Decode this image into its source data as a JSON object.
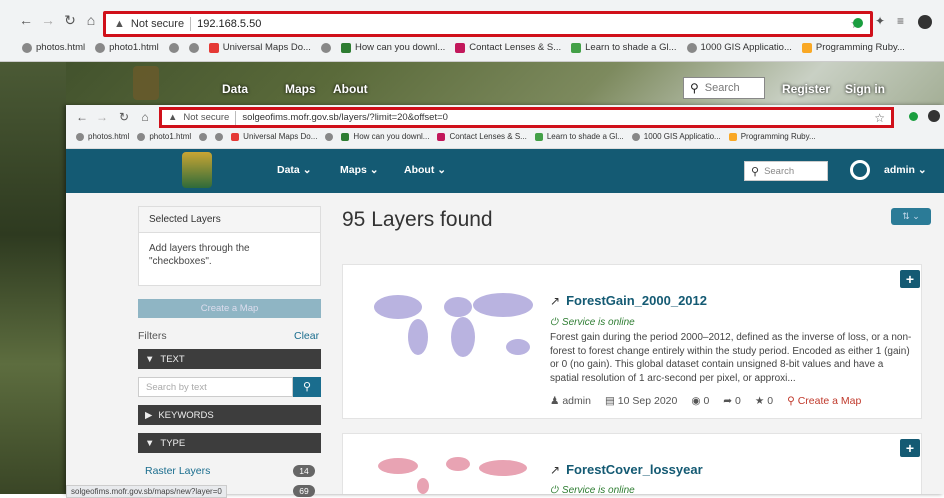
{
  "back_window": {
    "omnibox": {
      "security": "Not secure",
      "url": "192.168.5.50"
    },
    "bookmarks": [
      "photos.html",
      "photo1.html",
      "Universal Maps Do...",
      "How can you downl...",
      "Contact Lenses & S...",
      "Learn to shade a Gl...",
      "1000 GIS Applicatio...",
      "Programming Ruby..."
    ],
    "nav": {
      "data": "Data",
      "maps": "Maps",
      "about": "About",
      "search_placeholder": "Search",
      "register": "Register",
      "signin": "Sign in"
    }
  },
  "front_window": {
    "omnibox": {
      "security": "Not secure",
      "url": "solgeofims.mofr.gov.sb/layers/?limit=20&offset=0"
    },
    "bookmarks": [
      "photos.html",
      "photo1.html",
      "Universal Maps Do...",
      "How can you downl...",
      "Contact Lenses & S...",
      "Learn to shade a Gl...",
      "1000 GIS Applicatio...",
      "Programming Ruby..."
    ],
    "nav": {
      "data": "Data",
      "maps": "Maps",
      "about": "About",
      "search_placeholder": "Search",
      "user": "admin"
    },
    "sidebar": {
      "selected_layers_title": "Selected Layers",
      "selected_layers_hint": "Add layers through the \"checkboxes\".",
      "create_map": "Create a Map",
      "filters_label": "Filters",
      "clear": "Clear",
      "text_section": "TEXT",
      "search_placeholder": "Search by text",
      "keywords_section": "KEYWORDS",
      "type_section": "TYPE",
      "type_items": [
        {
          "label": "Raster Layers",
          "count": "14"
        },
        {
          "label": "",
          "count": "69"
        }
      ]
    },
    "main": {
      "heading": "95 Layers found",
      "layers": [
        {
          "title": "ForestGain_2000_2012",
          "status": "Service is online",
          "description": "Forest gain during the period 2000–2012, defined as the inverse of loss, or a non-forest to forest change entirely within the study period. Encoded as either 1 (gain) or 0 (no gain). This global dataset contain unsigned 8-bit values and have a spatial resolution of 1 arc-second per pixel, or approxi...",
          "owner": "admin",
          "date": "10 Sep 2020",
          "views": "0",
          "shares": "0",
          "rating": "0",
          "create_map": "Create a Map"
        },
        {
          "title": "ForestCover_lossyear",
          "status": "Service is online"
        }
      ]
    },
    "status_url": "solgeofims.mofr.gov.sb/maps/new?layer=0"
  },
  "colors": {
    "header": "#145a73",
    "red_highlight": "#d0101a",
    "create_map_red": "#c0392b"
  }
}
